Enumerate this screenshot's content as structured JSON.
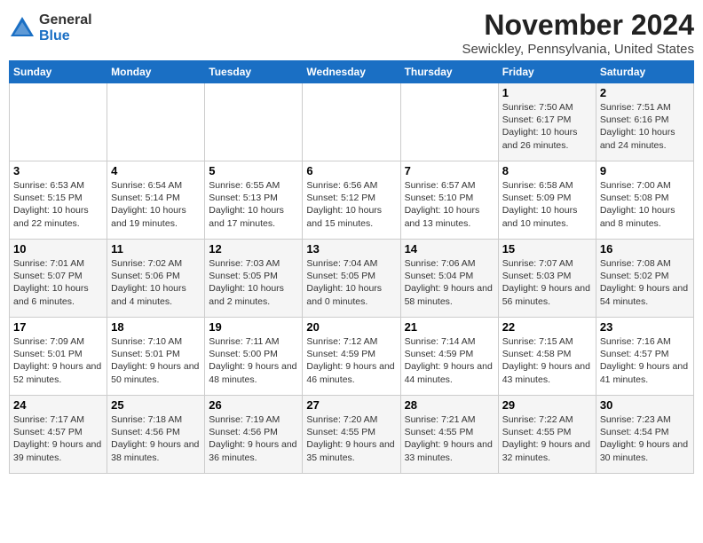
{
  "logo": {
    "general": "General",
    "blue": "Blue"
  },
  "title": "November 2024",
  "subtitle": "Sewickley, Pennsylvania, United States",
  "days_of_week": [
    "Sunday",
    "Monday",
    "Tuesday",
    "Wednesday",
    "Thursday",
    "Friday",
    "Saturday"
  ],
  "weeks": [
    [
      {
        "day": "",
        "info": ""
      },
      {
        "day": "",
        "info": ""
      },
      {
        "day": "",
        "info": ""
      },
      {
        "day": "",
        "info": ""
      },
      {
        "day": "",
        "info": ""
      },
      {
        "day": "1",
        "info": "Sunrise: 7:50 AM\nSunset: 6:17 PM\nDaylight: 10 hours and 26 minutes."
      },
      {
        "day": "2",
        "info": "Sunrise: 7:51 AM\nSunset: 6:16 PM\nDaylight: 10 hours and 24 minutes."
      }
    ],
    [
      {
        "day": "3",
        "info": "Sunrise: 6:53 AM\nSunset: 5:15 PM\nDaylight: 10 hours and 22 minutes."
      },
      {
        "day": "4",
        "info": "Sunrise: 6:54 AM\nSunset: 5:14 PM\nDaylight: 10 hours and 19 minutes."
      },
      {
        "day": "5",
        "info": "Sunrise: 6:55 AM\nSunset: 5:13 PM\nDaylight: 10 hours and 17 minutes."
      },
      {
        "day": "6",
        "info": "Sunrise: 6:56 AM\nSunset: 5:12 PM\nDaylight: 10 hours and 15 minutes."
      },
      {
        "day": "7",
        "info": "Sunrise: 6:57 AM\nSunset: 5:10 PM\nDaylight: 10 hours and 13 minutes."
      },
      {
        "day": "8",
        "info": "Sunrise: 6:58 AM\nSunset: 5:09 PM\nDaylight: 10 hours and 10 minutes."
      },
      {
        "day": "9",
        "info": "Sunrise: 7:00 AM\nSunset: 5:08 PM\nDaylight: 10 hours and 8 minutes."
      }
    ],
    [
      {
        "day": "10",
        "info": "Sunrise: 7:01 AM\nSunset: 5:07 PM\nDaylight: 10 hours and 6 minutes."
      },
      {
        "day": "11",
        "info": "Sunrise: 7:02 AM\nSunset: 5:06 PM\nDaylight: 10 hours and 4 minutes."
      },
      {
        "day": "12",
        "info": "Sunrise: 7:03 AM\nSunset: 5:05 PM\nDaylight: 10 hours and 2 minutes."
      },
      {
        "day": "13",
        "info": "Sunrise: 7:04 AM\nSunset: 5:05 PM\nDaylight: 10 hours and 0 minutes."
      },
      {
        "day": "14",
        "info": "Sunrise: 7:06 AM\nSunset: 5:04 PM\nDaylight: 9 hours and 58 minutes."
      },
      {
        "day": "15",
        "info": "Sunrise: 7:07 AM\nSunset: 5:03 PM\nDaylight: 9 hours and 56 minutes."
      },
      {
        "day": "16",
        "info": "Sunrise: 7:08 AM\nSunset: 5:02 PM\nDaylight: 9 hours and 54 minutes."
      }
    ],
    [
      {
        "day": "17",
        "info": "Sunrise: 7:09 AM\nSunset: 5:01 PM\nDaylight: 9 hours and 52 minutes."
      },
      {
        "day": "18",
        "info": "Sunrise: 7:10 AM\nSunset: 5:01 PM\nDaylight: 9 hours and 50 minutes."
      },
      {
        "day": "19",
        "info": "Sunrise: 7:11 AM\nSunset: 5:00 PM\nDaylight: 9 hours and 48 minutes."
      },
      {
        "day": "20",
        "info": "Sunrise: 7:12 AM\nSunset: 4:59 PM\nDaylight: 9 hours and 46 minutes."
      },
      {
        "day": "21",
        "info": "Sunrise: 7:14 AM\nSunset: 4:59 PM\nDaylight: 9 hours and 44 minutes."
      },
      {
        "day": "22",
        "info": "Sunrise: 7:15 AM\nSunset: 4:58 PM\nDaylight: 9 hours and 43 minutes."
      },
      {
        "day": "23",
        "info": "Sunrise: 7:16 AM\nSunset: 4:57 PM\nDaylight: 9 hours and 41 minutes."
      }
    ],
    [
      {
        "day": "24",
        "info": "Sunrise: 7:17 AM\nSunset: 4:57 PM\nDaylight: 9 hours and 39 minutes."
      },
      {
        "day": "25",
        "info": "Sunrise: 7:18 AM\nSunset: 4:56 PM\nDaylight: 9 hours and 38 minutes."
      },
      {
        "day": "26",
        "info": "Sunrise: 7:19 AM\nSunset: 4:56 PM\nDaylight: 9 hours and 36 minutes."
      },
      {
        "day": "27",
        "info": "Sunrise: 7:20 AM\nSunset: 4:55 PM\nDaylight: 9 hours and 35 minutes."
      },
      {
        "day": "28",
        "info": "Sunrise: 7:21 AM\nSunset: 4:55 PM\nDaylight: 9 hours and 33 minutes."
      },
      {
        "day": "29",
        "info": "Sunrise: 7:22 AM\nSunset: 4:55 PM\nDaylight: 9 hours and 32 minutes."
      },
      {
        "day": "30",
        "info": "Sunrise: 7:23 AM\nSunset: 4:54 PM\nDaylight: 9 hours and 30 minutes."
      }
    ]
  ]
}
